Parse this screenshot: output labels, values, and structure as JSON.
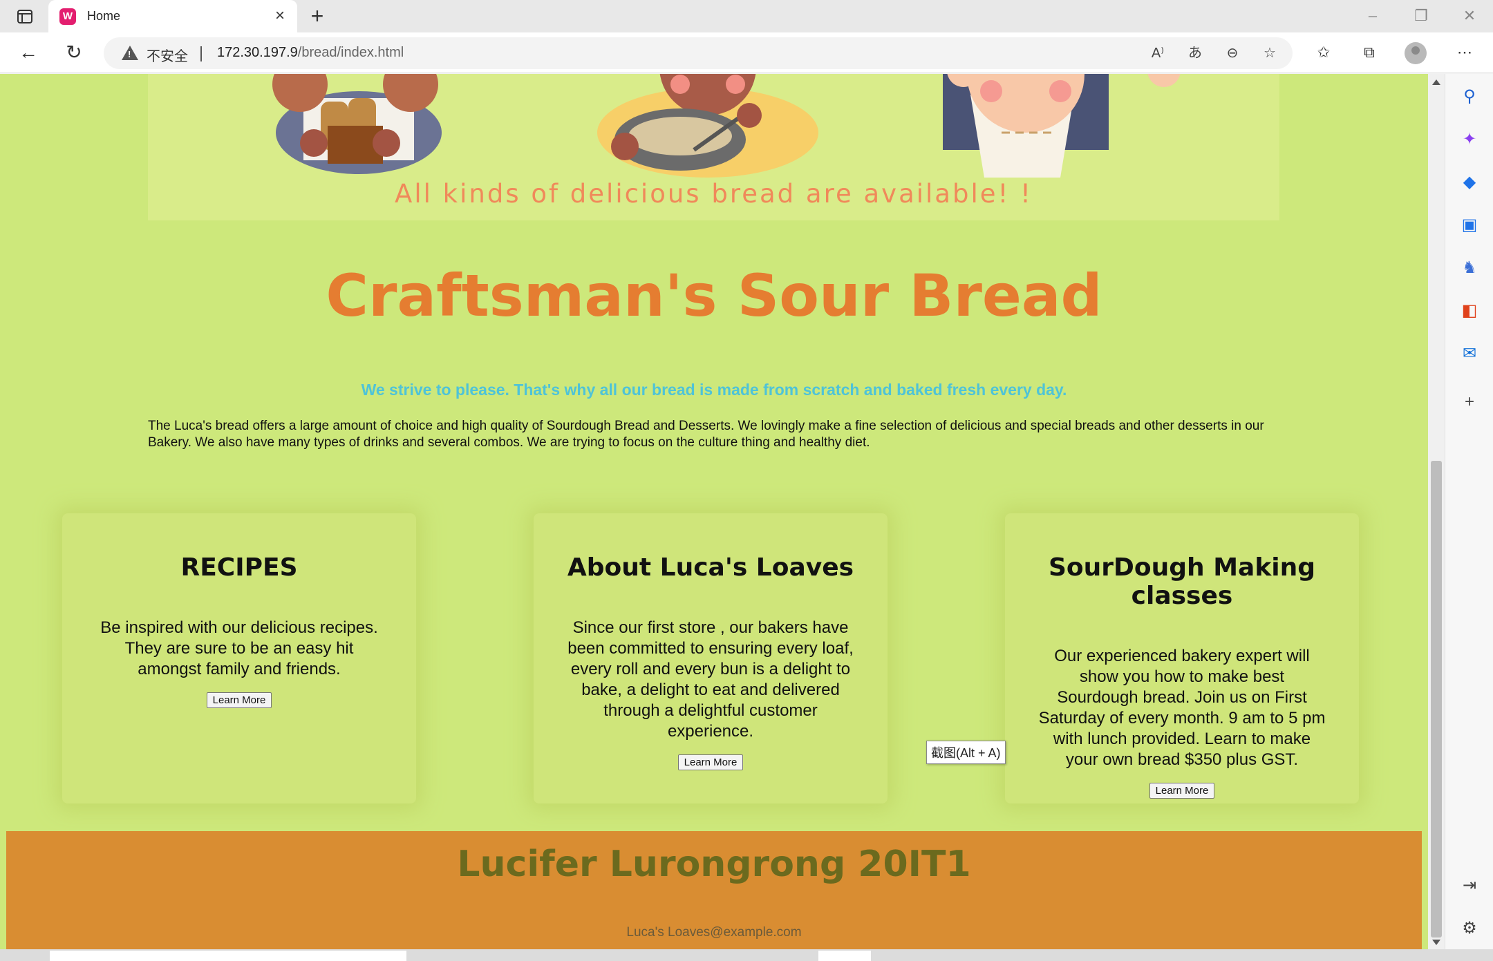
{
  "browser": {
    "tab_title": "Home",
    "favicon_letter": "W",
    "insecure_label": "不安全",
    "url_host": "172.30.197.9",
    "url_path": "/bread/index.html"
  },
  "banner": {
    "text": "All kinds of delicious bread are available! !"
  },
  "page": {
    "title": "Craftsman's Sour Bread",
    "tagline": "We strive to please. That's why all our bread is made from scratch and baked fresh every day.",
    "intro": "The Luca's bread offers a large amount of choice and high quality of Sourdough Bread and Desserts. We lovingly make a fine selection of delicious and special breads and other desserts in our Bakery. We also have many types of drinks and several combos. We are trying to focus on the culture thing and healthy diet."
  },
  "cards": [
    {
      "heading": "RECIPES",
      "text": "Be inspired with our delicious recipes. They are sure to be an easy hit amongst family and friends.",
      "button": "Learn More"
    },
    {
      "heading": "About Luca's Loaves",
      "text": "Since our first store , our bakers have been committed to ensuring every loaf, every roll and every bun is a delight to bake, a delight to eat and delivered through a delightful customer experience.",
      "button": "Learn More"
    },
    {
      "heading": "SourDough Making classes",
      "text": "Our experienced bakery expert will show you how to make best Sourdough bread. Join us on First Saturday of every month. 9 am to 5 pm with lunch provided. Learn to make your own bread $350 plus GST.",
      "button": "Learn More"
    }
  ],
  "tooltip": "截图(Alt + A)",
  "footer": {
    "title": "Lucifer Lurongrong 20IT1",
    "email": "Luca's Loaves@example.com"
  },
  "colors": {
    "page_bg": "#cde87b",
    "title": "#e57d31",
    "tagline": "#4ec3d8",
    "footer_bg": "#d98d32"
  }
}
